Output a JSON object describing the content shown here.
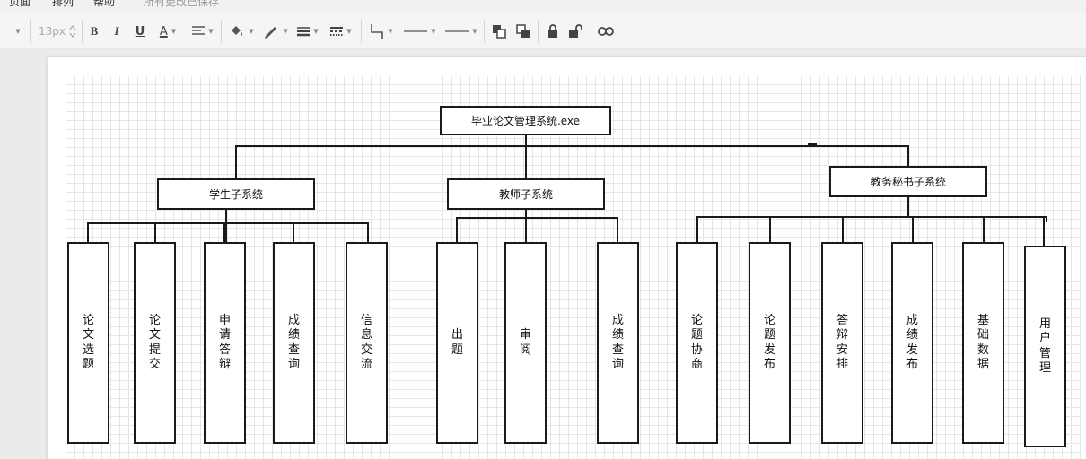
{
  "menu": {
    "items": [
      "页面",
      "排列",
      "帮助"
    ],
    "status": "所有更改已保存"
  },
  "toolbar": {
    "font_size": "13px",
    "bold_label": "B",
    "italic_label": "I",
    "underline_label": "U",
    "font_color_label": "A"
  },
  "diagram": {
    "root": "毕业论文管理系统.exe",
    "subsystems": [
      {
        "label": "学生子系统",
        "modules": [
          "论文选题",
          "论文提交",
          "申请答辩",
          "成绩查询",
          "信息交流"
        ]
      },
      {
        "label": "教师子系统",
        "modules": [
          "出题",
          "审阅",
          "成绩查询"
        ]
      },
      {
        "label": "教务秘书子系统",
        "modules": [
          "论题协商",
          "论题发布",
          "答辩安排",
          "成绩发布",
          "基础数据",
          "用户管理"
        ]
      }
    ]
  }
}
